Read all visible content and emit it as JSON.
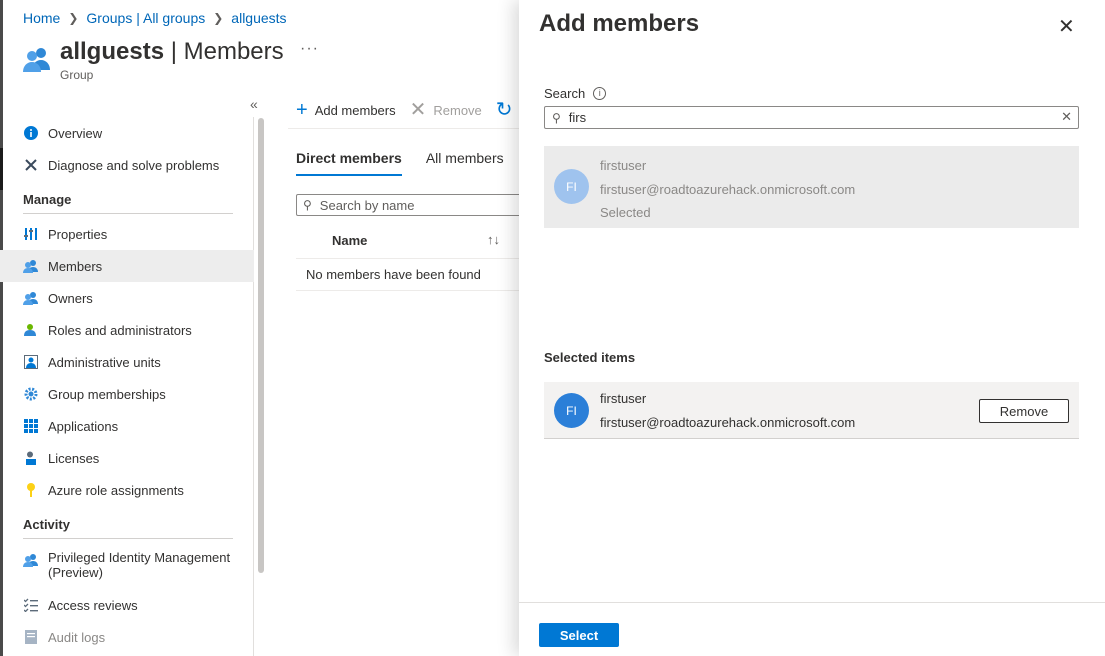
{
  "breadcrumb": [
    "Home",
    "Groups | All groups",
    "allguests"
  ],
  "page": {
    "title_bold": "allguests",
    "title_rest": " | Members",
    "subtitle": "Group",
    "more": "···"
  },
  "sidebar": {
    "collapse": "«",
    "top_items": [
      {
        "label": "Overview",
        "icon": "info-icon"
      },
      {
        "label": "Diagnose and solve problems",
        "icon": "wrench-icon"
      }
    ],
    "manage_label": "Manage",
    "manage_items": [
      {
        "label": "Properties",
        "icon": "properties-icon"
      },
      {
        "label": "Members",
        "icon": "members-icon",
        "active": true
      },
      {
        "label": "Owners",
        "icon": "owners-icon"
      },
      {
        "label": "Roles and administrators",
        "icon": "roles-icon"
      },
      {
        "label": "Administrative units",
        "icon": "admin-units-icon"
      },
      {
        "label": "Group memberships",
        "icon": "gear-icon"
      },
      {
        "label": "Applications",
        "icon": "grid-icon"
      },
      {
        "label": "Licenses",
        "icon": "license-icon"
      },
      {
        "label": "Azure role assignments",
        "icon": "key-icon"
      }
    ],
    "activity_label": "Activity",
    "activity_items": [
      {
        "label": "Privileged Identity Management",
        "label2": "(Preview)",
        "icon": "pim-icon"
      },
      {
        "label": "Access reviews",
        "icon": "checklist-icon"
      },
      {
        "label": "Audit logs",
        "icon": "log-icon"
      }
    ]
  },
  "toolbar": {
    "add": "Add members",
    "remove": "Remove"
  },
  "tabs": [
    "Direct members",
    "All members"
  ],
  "member_search": {
    "placeholder": "Search by name"
  },
  "table": {
    "col_name": "Name",
    "sort": "↑↓",
    "empty": "No members have been found"
  },
  "panel": {
    "title": "Add members",
    "search_label": "Search",
    "search_value": "firs",
    "result": {
      "initials": "FI",
      "name": "firstuser",
      "email": "firstuser@roadtoazurehack.onmicrosoft.com",
      "status": "Selected"
    },
    "selected_label": "Selected items",
    "selected": {
      "initials": "FI",
      "name": "firstuser",
      "email": "firstuser@roadtoazurehack.onmicrosoft.com",
      "remove": "Remove"
    },
    "select_button": "Select"
  },
  "colors": {
    "accent": "#0078d4",
    "link": "#0067b8",
    "avatar_selected": "#2b7fd8",
    "avatar_result": "#9fc3ee"
  }
}
